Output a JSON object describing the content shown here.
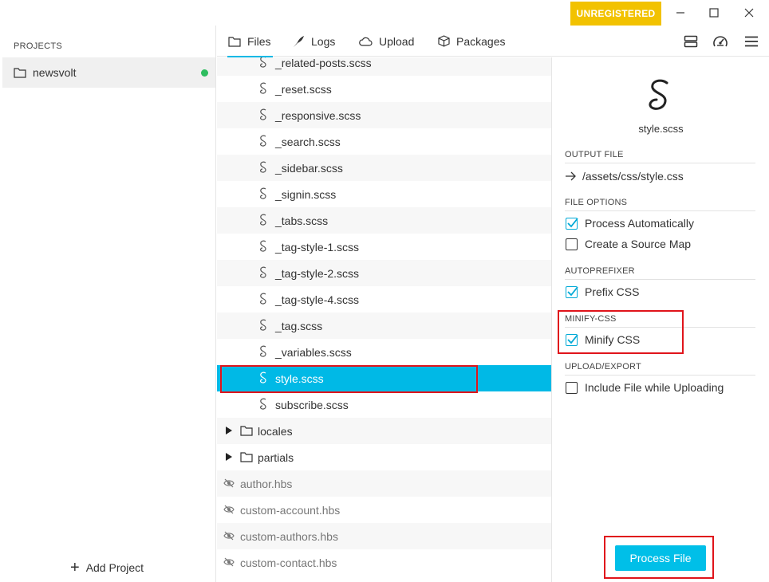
{
  "titlebar": {
    "unregistered_label": "UNREGISTERED"
  },
  "sidebar": {
    "heading": "PROJECTS",
    "projects": [
      {
        "name": "newsvolt",
        "status_color": "#2ebd5f"
      }
    ],
    "add_project_label": "Add Project"
  },
  "tabs": [
    {
      "label": "Files",
      "icon": "folder-icon",
      "active": true
    },
    {
      "label": "Logs",
      "icon": "feather-icon"
    },
    {
      "label": "Upload",
      "icon": "cloud-icon"
    },
    {
      "label": "Packages",
      "icon": "package-icon"
    }
  ],
  "files": [
    {
      "name": "_related-posts.scss",
      "type": "scss"
    },
    {
      "name": "_reset.scss",
      "type": "scss"
    },
    {
      "name": "_responsive.scss",
      "type": "scss"
    },
    {
      "name": "_search.scss",
      "type": "scss"
    },
    {
      "name": "_sidebar.scss",
      "type": "scss"
    },
    {
      "name": "_signin.scss",
      "type": "scss"
    },
    {
      "name": "_tabs.scss",
      "type": "scss"
    },
    {
      "name": "_tag-style-1.scss",
      "type": "scss"
    },
    {
      "name": "_tag-style-2.scss",
      "type": "scss"
    },
    {
      "name": "_tag-style-4.scss",
      "type": "scss"
    },
    {
      "name": "_tag.scss",
      "type": "scss"
    },
    {
      "name": "_variables.scss",
      "type": "scss"
    },
    {
      "name": "style.scss",
      "type": "scss",
      "selected": true
    },
    {
      "name": "subscribe.scss",
      "type": "scss"
    },
    {
      "name": "locales",
      "type": "folder"
    },
    {
      "name": "partials",
      "type": "folder"
    },
    {
      "name": "author.hbs",
      "type": "hidden"
    },
    {
      "name": "custom-account.hbs",
      "type": "hidden"
    },
    {
      "name": "custom-authors.hbs",
      "type": "hidden"
    },
    {
      "name": "custom-contact.hbs",
      "type": "hidden"
    }
  ],
  "detail": {
    "filename": "style.scss",
    "output_file_label": "OUTPUT FILE",
    "output_path": "/assets/css/style.css",
    "file_options_label": "FILE OPTIONS",
    "process_automatically": {
      "label": "Process Automatically",
      "checked": true
    },
    "source_map": {
      "label": "Create a Source Map",
      "checked": false
    },
    "autoprefixer_label": "AUTOPREFIXER",
    "prefix_css": {
      "label": "Prefix CSS",
      "checked": true
    },
    "minify_label": "MINIFY-CSS",
    "minify_css": {
      "label": "Minify CSS",
      "checked": true
    },
    "upload_export_label": "UPLOAD/EXPORT",
    "include_upload": {
      "label": "Include File while Uploading",
      "checked": false
    },
    "process_button_label": "Process File"
  },
  "colors": {
    "accent": "#00b9e6",
    "unregistered_badge": "#f2c200",
    "highlight": "#e0141b"
  }
}
